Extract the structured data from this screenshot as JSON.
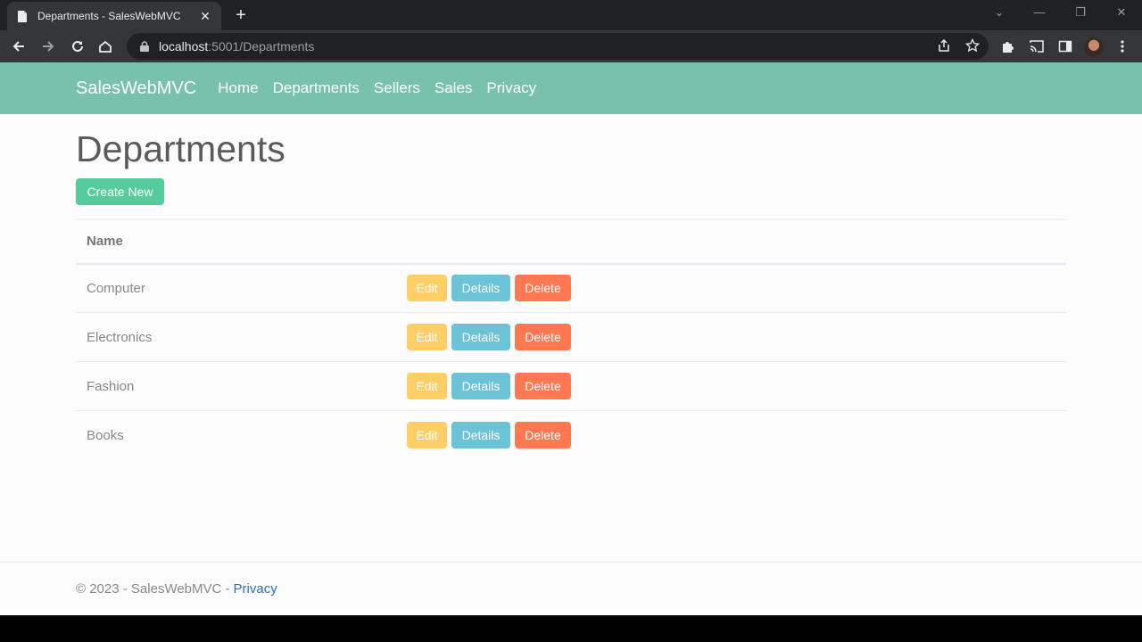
{
  "browser": {
    "tab_title": "Departments - SalesWebMVC",
    "url_host": "localhost",
    "url_path": ":5001/Departments"
  },
  "navbar": {
    "brand": "SalesWebMVC",
    "links": [
      "Home",
      "Departments",
      "Sellers",
      "Sales",
      "Privacy"
    ]
  },
  "main": {
    "title": "Departments",
    "create_label": "Create New",
    "table": {
      "headers": [
        "Name"
      ],
      "rows": [
        {
          "name": "Computer"
        },
        {
          "name": "Electronics"
        },
        {
          "name": "Fashion"
        },
        {
          "name": "Books"
        }
      ],
      "action_labels": {
        "edit": "Edit",
        "details": "Details",
        "delete": "Delete"
      }
    }
  },
  "footer": {
    "text": "© 2023 - SalesWebMVC -",
    "link": "Privacy"
  },
  "colors": {
    "navbar": "#78c2ad",
    "create": "#56cc9d",
    "edit": "#ffce67",
    "details": "#6cc3d5",
    "delete": "#ff7851"
  }
}
